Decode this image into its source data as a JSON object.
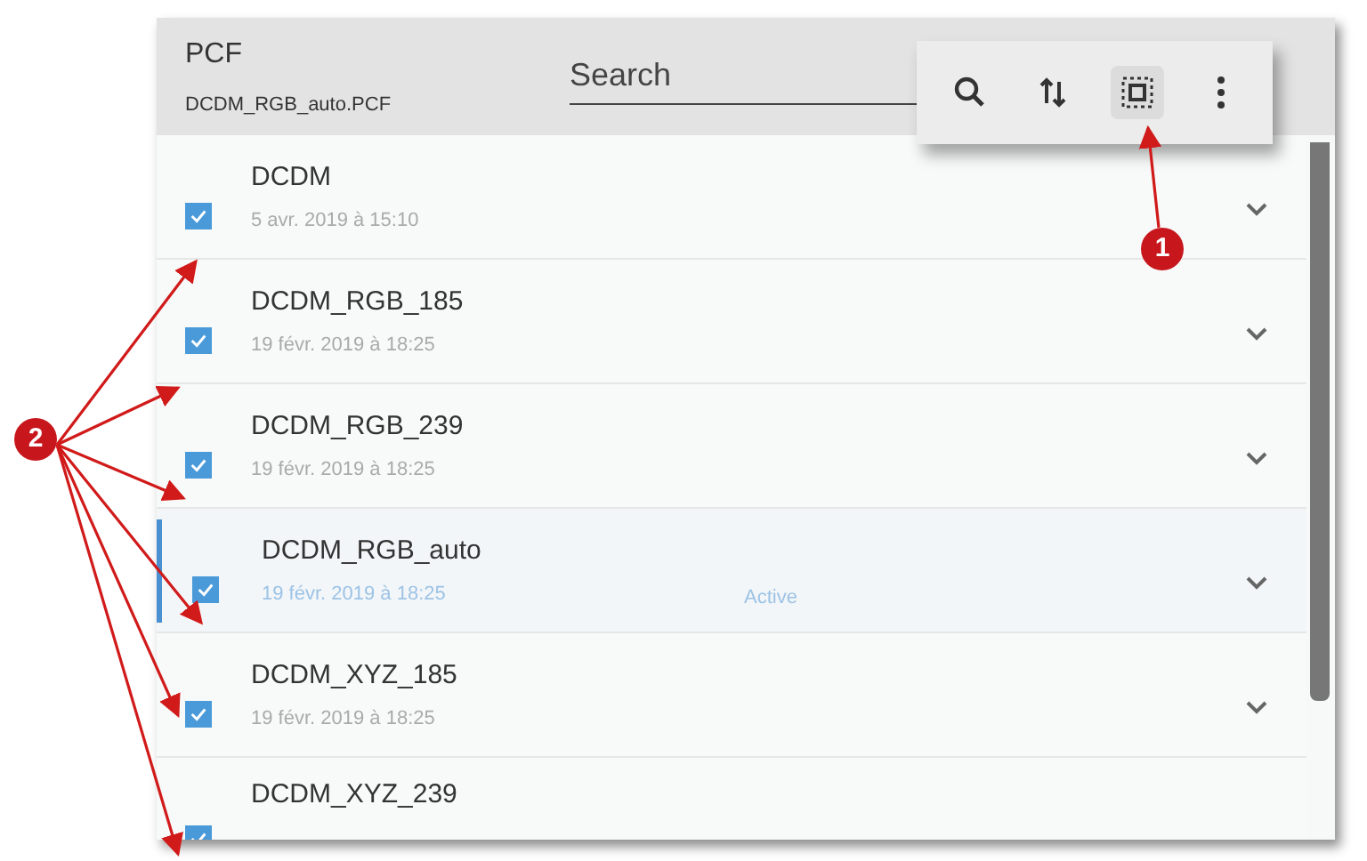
{
  "header": {
    "title": "PCF",
    "subtitle": "DCDM_RGB_auto.PCF",
    "search": {
      "placeholder": "Search"
    }
  },
  "toolbar": [
    {
      "selected": false
    },
    {
      "selected": false
    },
    {
      "selected": true
    },
    {
      "selected": false
    }
  ],
  "files": [
    {
      "name": "DCDM",
      "date": "5 avr. 2019 à 15:10",
      "checked": true,
      "selected": false
    },
    {
      "name": "DCDM_RGB_185",
      "date": "19 févr. 2019 à 18:25",
      "checked": true,
      "selected": false
    },
    {
      "name": "DCDM_RGB_239",
      "date": "19 févr. 2019 à 18:25",
      "checked": true,
      "selected": false
    },
    {
      "name": "DCDM_RGB_auto",
      "date": "19 févr. 2019 à 18:25",
      "status": "Active",
      "checked": true,
      "selected": true
    },
    {
      "name": "DCDM_XYZ_185",
      "date": "19 févr. 2019 à 18:25",
      "checked": true,
      "selected": false
    },
    {
      "name": "DCDM_XYZ_239",
      "checked": true,
      "selected": false
    }
  ],
  "callouts": [
    {
      "label": "1"
    },
    {
      "label": "2"
    }
  ]
}
